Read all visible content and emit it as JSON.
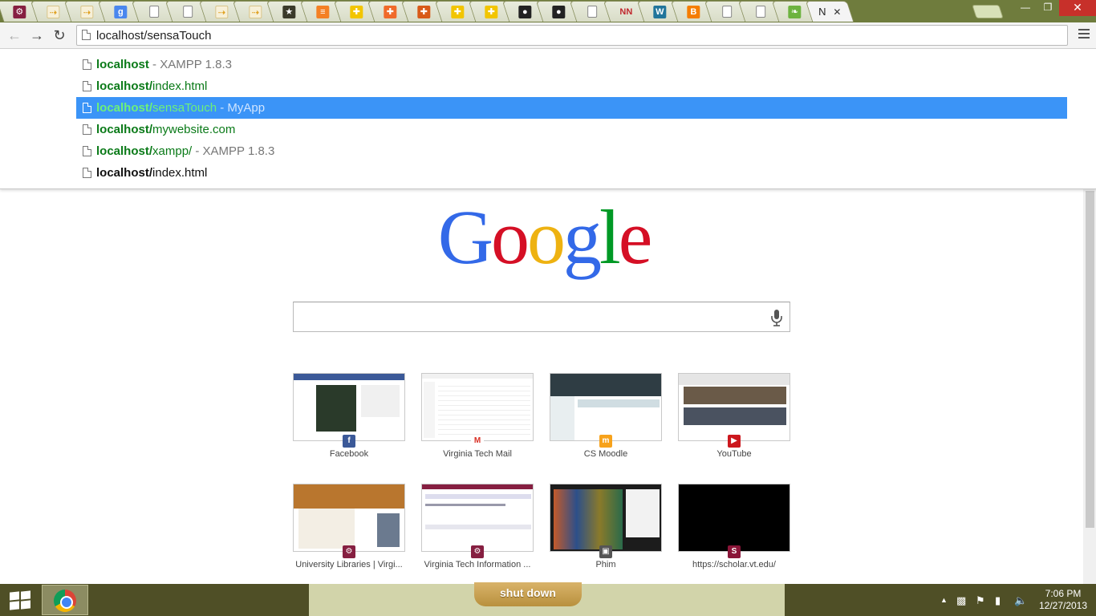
{
  "window": {
    "active_tab_label": "N",
    "active_tab_close": "✕",
    "controls": {
      "minimize": "—",
      "restore": "❐",
      "close": "✕"
    }
  },
  "tabs": [
    {
      "icon": "vt-logo-icon",
      "color": "#861f41",
      "glyph": "⚙"
    },
    {
      "icon": "arrow-page-icon",
      "color": "#e8b94a",
      "glyph": "⇢"
    },
    {
      "icon": "arrow-page-icon",
      "color": "#e8b94a",
      "glyph": "⇢"
    },
    {
      "icon": "google-icon",
      "color": "#4a87ee",
      "glyph": "g"
    },
    {
      "icon": "blank-page-icon",
      "color": "#ffffff",
      "glyph": ""
    },
    {
      "icon": "blank-page-icon",
      "color": "#ffffff",
      "glyph": ""
    },
    {
      "icon": "arrow-page-icon",
      "color": "#e8b94a",
      "glyph": "⇢"
    },
    {
      "icon": "arrow-page-icon",
      "color": "#e8b94a",
      "glyph": "⇢"
    },
    {
      "icon": "star-badge-icon",
      "color": "#3a3a2a",
      "glyph": "★"
    },
    {
      "icon": "stackoverflow-icon",
      "color": "#f48024",
      "glyph": "≡"
    },
    {
      "icon": "plus-yellow-icon",
      "color": "#f2c500",
      "glyph": "✚"
    },
    {
      "icon": "plus-orange-icon",
      "color": "#f06a2a",
      "glyph": "✚"
    },
    {
      "icon": "plus-darkorange-icon",
      "color": "#d85a18",
      "glyph": "✚"
    },
    {
      "icon": "plus-yellow-icon",
      "color": "#f2c500",
      "glyph": "✚"
    },
    {
      "icon": "plus-yellow-icon",
      "color": "#f2c500",
      "glyph": "✚"
    },
    {
      "icon": "github-icon",
      "color": "#222222",
      "glyph": "●"
    },
    {
      "icon": "github-icon",
      "color": "#222222",
      "glyph": "●"
    },
    {
      "icon": "blank-page-icon",
      "color": "#ffffff",
      "glyph": ""
    },
    {
      "icon": "nn-icon",
      "color": "#c0272d",
      "glyph": "NN"
    },
    {
      "icon": "wordpress-icon",
      "color": "#21759b",
      "glyph": "W"
    },
    {
      "icon": "blogger-icon",
      "color": "#f57d00",
      "glyph": "B"
    },
    {
      "icon": "blank-page-icon",
      "color": "#ffffff",
      "glyph": ""
    },
    {
      "icon": "blank-page-icon",
      "color": "#ffffff",
      "glyph": ""
    },
    {
      "icon": "leaf-icon",
      "color": "#6db33f",
      "glyph": "❧"
    }
  ],
  "toolbar": {
    "url": "localhost/sensaTouch"
  },
  "suggestions": [
    {
      "host": "localhost",
      "path": "",
      "desc": " - XAMPP 1.8.3",
      "selected": false,
      "plain": false
    },
    {
      "host": "localhost/",
      "path": "index.html",
      "desc": "",
      "selected": false,
      "plain": false
    },
    {
      "host": "localhost/",
      "path": "sensaTouch",
      "desc": " - MyApp",
      "selected": true,
      "plain": false
    },
    {
      "host": "localhost/",
      "path": "mywebsite.com",
      "desc": "",
      "selected": false,
      "plain": false
    },
    {
      "host": "localhost/",
      "path": "xampp/",
      "desc": " - XAMPP 1.8.3",
      "selected": false,
      "plain": false
    },
    {
      "host": "localhost/",
      "path": "index.html",
      "desc": "",
      "selected": false,
      "plain": true
    }
  ],
  "logo": {
    "letters": [
      "G",
      "o",
      "o",
      "g",
      "l",
      "e"
    ],
    "colors": [
      "#3369e8",
      "#d50f25",
      "#eeb211",
      "#3369e8",
      "#009925",
      "#d50f25"
    ]
  },
  "search": {
    "value": ""
  },
  "most_visited": [
    {
      "label": "Facebook",
      "icon": "facebook-icon",
      "fav_color": "#3b5998",
      "glyph": "f"
    },
    {
      "label": "Virginia Tech Mail",
      "icon": "gmail-icon",
      "fav_color": "#ffffff",
      "glyph": "M"
    },
    {
      "label": "CS Moodle",
      "icon": "moodle-icon",
      "fav_color": "#f7a21b",
      "glyph": "m"
    },
    {
      "label": "YouTube",
      "icon": "youtube-icon",
      "fav_color": "#cc181e",
      "glyph": "▶"
    },
    {
      "label": "University Libraries | Virgi...",
      "icon": "vt-logo-icon",
      "fav_color": "#861f41",
      "glyph": "⚙"
    },
    {
      "label": "Virginia Tech Information ...",
      "icon": "vt-logo-icon",
      "fav_color": "#861f41",
      "glyph": "⚙"
    },
    {
      "label": "Phim",
      "icon": "phim-icon",
      "fav_color": "#555555",
      "glyph": "▣"
    },
    {
      "label": "https://scholar.vt.edu/",
      "icon": "scholar-icon",
      "fav_color": "#8a1538",
      "glyph": "S"
    }
  ],
  "taskbar": {
    "shutdown_label": "shut down",
    "time": "7:06 PM",
    "date": "12/27/2013"
  }
}
